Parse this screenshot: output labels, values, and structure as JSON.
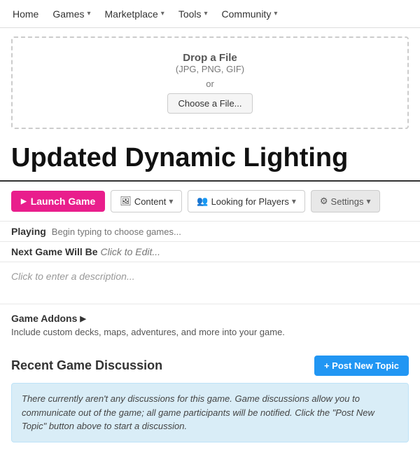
{
  "nav": {
    "items": [
      {
        "label": "Home",
        "has_dropdown": false
      },
      {
        "label": "Games",
        "has_dropdown": true
      },
      {
        "label": "Marketplace",
        "has_dropdown": true
      },
      {
        "label": "Tools",
        "has_dropdown": true
      },
      {
        "label": "Community",
        "has_dropdown": true
      }
    ]
  },
  "dropzone": {
    "title": "Drop a File",
    "subtitle": "(JPG, PNG, GIF)",
    "or": "or",
    "button_label": "Choose a File..."
  },
  "game": {
    "title": "Updated Dynamic Lighting"
  },
  "actions": {
    "launch_label": "Launch Game",
    "content_label": "Content",
    "looking_label": "Looking for Players",
    "settings_label": "Settings"
  },
  "playing": {
    "label": "Playing",
    "placeholder": "Begin typing to choose games..."
  },
  "next_game": {
    "label": "Next Game Will Be",
    "value": "Click to Edit..."
  },
  "description": {
    "placeholder": "Click to enter a description..."
  },
  "addons": {
    "title": "Game Addons",
    "description": "Include custom decks, maps, adventures, and more into your game."
  },
  "discussion": {
    "title": "Recent Game Discussion",
    "post_button": "+ Post New Topic",
    "empty_text": "There currently aren't any discussions for this game. Game discussions allow you to communicate out of the game; all game participants will be notified. Click the \"Post New Topic\" button above to start a discussion."
  }
}
